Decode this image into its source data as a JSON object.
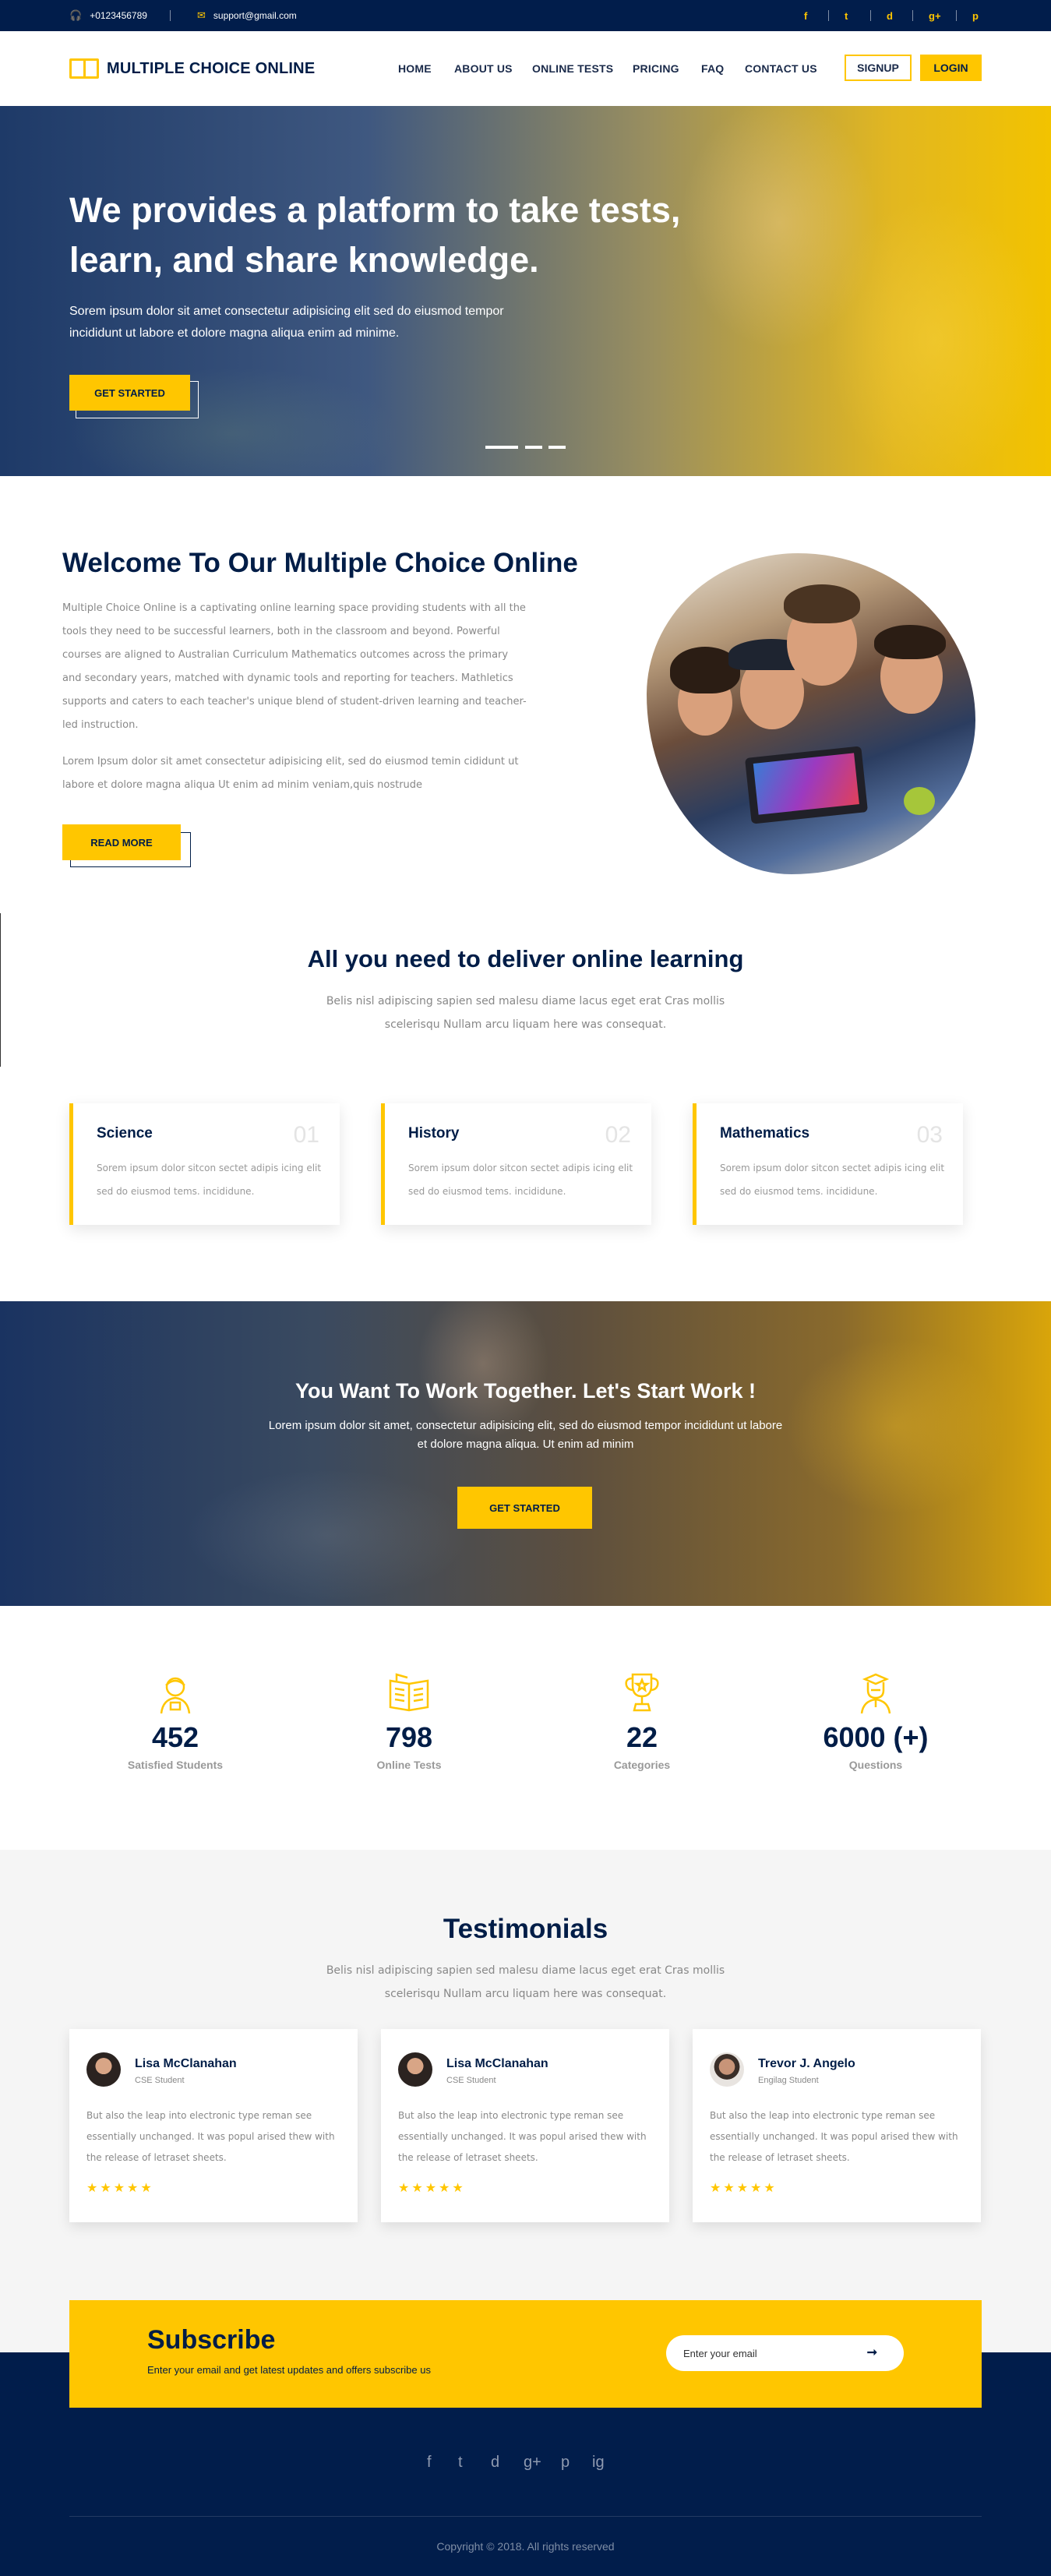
{
  "topbar": {
    "phone": "+0123456789",
    "email": "support@gmail.com",
    "phone_icon": "headset-icon",
    "email_icon": "envelope-icon",
    "social": [
      "f",
      "t",
      "d",
      "g+",
      "p"
    ]
  },
  "nav": {
    "logo_text": "MULTIPLE CHOICE ONLINE",
    "menu": [
      "HOME",
      "ABOUT US",
      "ONLINE TESTS",
      "PRICING",
      "FAQ",
      "CONTACT US"
    ],
    "signup": "SIGNUP",
    "login": "LOGIN"
  },
  "hero": {
    "title": "We provides a platform to take tests, learn, and share knowledge.",
    "text": "Sorem ipsum dolor sit amet consectetur adipisicing elit sed do eiusmod tempor incididunt ut labore et dolore magna aliqua enim ad minime.",
    "button": "GET STARTED"
  },
  "welcome": {
    "title": "Welcome To Our Multiple Choice Online",
    "para1": "Multiple Choice Online is a captivating online learning space providing students with all the tools they need to be successful learners, both in the classroom and beyond. Powerful courses are aligned to Australian Curriculum Mathematics outcomes across the primary and secondary years, matched with dynamic tools and reporting for teachers. Mathletics supports and caters to each teacher's unique blend of student-driven learning and teacher-led instruction.",
    "para2": "Lorem Ipsum dolor sit amet consectetur adipisicing elit, sed do eiusmod temin cididunt ut labore et dolore magna aliqua Ut enim ad minim veniam,quis nostrude",
    "button": "READ MORE"
  },
  "features": {
    "title": "All you need to deliver online learning",
    "subtitle": "Belis nisl adipiscing sapien sed malesu diame lacus eget erat Cras mollis scelerisqu Nullam arcu liquam here was consequat.",
    "cards": [
      {
        "title": "Science",
        "num": "01",
        "text": "Sorem ipsum dolor sitcon sectet adipis icing elit sed do eiusmod tems. incididune."
      },
      {
        "title": "History",
        "num": "02",
        "text": "Sorem ipsum dolor sitcon sectet adipis icing elit sed do eiusmod tems. incididune."
      },
      {
        "title": "Mathematics",
        "num": "03",
        "text": "Sorem ipsum dolor sitcon sectet adipis icing elit sed do eiusmod tems. incididune."
      }
    ]
  },
  "cta": {
    "title": "You Want To Work Together. Let's Start Work !",
    "text": "Lorem ipsum dolor sit amet, consectetur adipisicing elit, sed do eiusmod tempor incididunt ut labore et dolore magna aliqua. Ut enim ad minim",
    "button": "GET STARTED"
  },
  "stats": [
    {
      "value": "452",
      "label": "Satisfied Students",
      "icon": "student-icon"
    },
    {
      "value": "798",
      "label": "Online Tests",
      "icon": "book-icon"
    },
    {
      "value": "22",
      "label": "Categories",
      "icon": "trophy-icon"
    },
    {
      "value": "6000 (+)",
      "label": "Questions",
      "icon": "graduate-icon"
    }
  ],
  "testimonials": {
    "title": "Testimonials",
    "subtitle": "Belis nisl adipiscing sapien sed malesu diame lacus eget erat Cras mollis scelerisqu Nullam arcu liquam here was consequat.",
    "items": [
      {
        "name": "Lisa McClanahan",
        "role": "CSE Student",
        "text": "But also the leap into electronic type reman see essentially unchanged. It was popul arised thew with the release of letraset sheets.",
        "stars": "★★★★★"
      },
      {
        "name": "Lisa McClanahan",
        "role": "CSE Student",
        "text": "But also the leap into electronic type reman see essentially unchanged. It was popul arised thew with the release of letraset sheets.",
        "stars": "★★★★★"
      },
      {
        "name": "Trevor J. Angelo",
        "role": "Engilag Student",
        "text": "But also the leap into electronic type reman see essentially unchanged. It was popul arised thew with the release of letraset sheets.",
        "stars": "★★★★★"
      }
    ]
  },
  "subscribe": {
    "title": "Subscribe",
    "text": "Enter your email and get latest updates and offers subscribe us",
    "placeholder": "Enter your email",
    "arrow": "➞"
  },
  "footer": {
    "social": [
      "f",
      "t",
      "d",
      "g+",
      "p",
      "ig"
    ],
    "copyright": "Copyright © 2018. All rights reserved"
  },
  "colors": {
    "navy": "#011d4b",
    "yellow": "#ffc600"
  }
}
